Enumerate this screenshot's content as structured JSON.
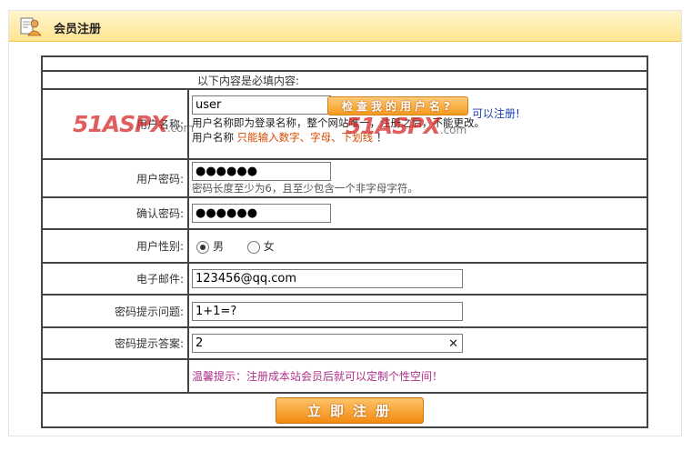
{
  "header": {
    "title": "会员注册"
  },
  "form": {
    "required_note": "以下内容是必填内容:",
    "username": {
      "label": "用户名称:",
      "value": "user",
      "check_button": "检查我的用户名?",
      "availability": "可以注册",
      "availability_suffix": "!",
      "hint_line1": "用户名称即为登录名称，整个网站唯一，注册之后，不能更改。",
      "hint_line2_prefix": "用户名称",
      "hint_line2_rule": "只能输入数字、字母、下划线",
      "hint_line2_suffix": "！"
    },
    "password": {
      "label": "用户密码:",
      "value": "●●●●●●",
      "hint": "密码长度至少为6，且至少包含一个非字母字符。"
    },
    "confirm": {
      "label": "确认密码:",
      "value": "●●●●●●"
    },
    "gender": {
      "label": "用户性别:",
      "options": [
        "男",
        "女"
      ],
      "selected": "男"
    },
    "email": {
      "label": "电子邮件:",
      "value": "123456@qq.com"
    },
    "question": {
      "label": "密码提示问题:",
      "value": "1+1=?"
    },
    "answer": {
      "label": "密码提示答案:",
      "value": "2",
      "clear_icon": "✕"
    },
    "tip": "温馨提示：注册成本站会员后就可以定制个性空间！",
    "submit_label": "立即注册"
  },
  "watermark": {
    "brand": "51ASPX",
    "suffix": ".com"
  },
  "colors": {
    "header_bg": "#ffe58f",
    "button": "#f28a10",
    "link": "#1a3fb4",
    "rule_text": "#d64a00",
    "tip_text": "#b0308a"
  },
  "icons": {
    "header": "user-profile-icon"
  }
}
